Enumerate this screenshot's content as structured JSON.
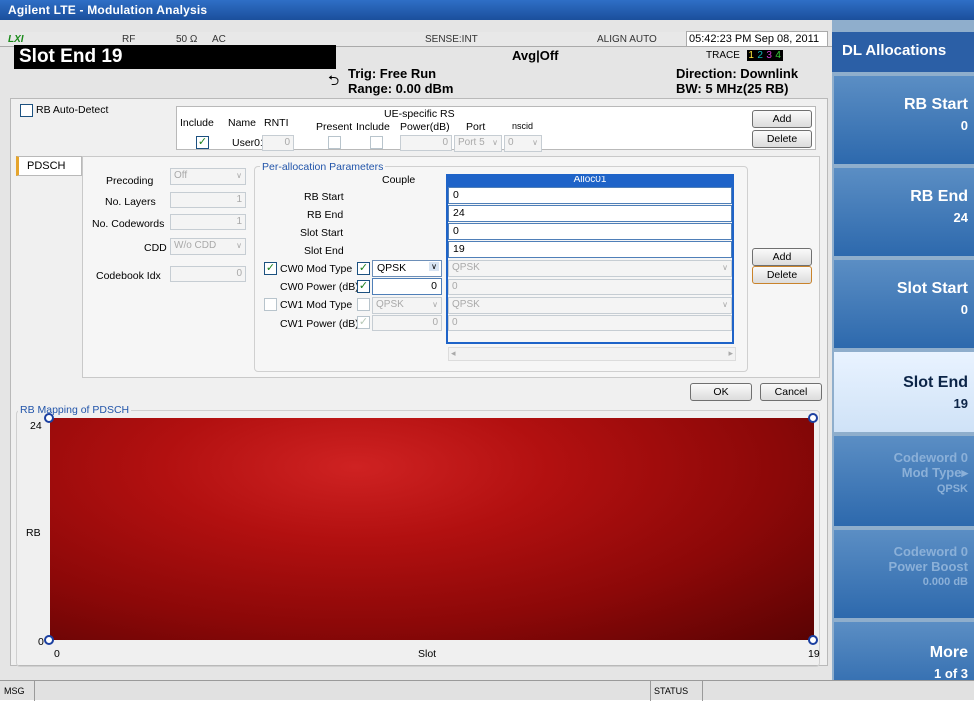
{
  "window": {
    "title": "Agilent LTE - Modulation Analysis"
  },
  "status_row": {
    "lxi": "LXI",
    "rf": "RF",
    "impedance": "50 Ω",
    "coupling": "AC",
    "sense": "SENSE:INT",
    "align": "ALIGN AUTO",
    "datetime": "05:42:23 PM Sep 08, 2011"
  },
  "header": {
    "active_param": "Slot End 19",
    "avg": "Avg|Off",
    "trig": "Trig: Free Run",
    "range": "Range: 0.00 dBm",
    "direction": "Direction: Downlink",
    "bw": "BW: 5 MHz(25 RB)",
    "trace_label": "TRACE",
    "trace_nums": [
      "1",
      "2",
      "3",
      "4"
    ]
  },
  "dialog": {
    "rb_auto_detect": "RB Auto-Detect",
    "user_table": {
      "headers": {
        "include": "Include",
        "name": "Name",
        "rnti": "RNTI",
        "ue_rs": "UE-specific RS",
        "present": "Present",
        "include2": "Include",
        "power": "Power(dB)",
        "port": "Port",
        "nscid": "nscid"
      },
      "row": {
        "name": "User01",
        "rnti": "0",
        "power": "0",
        "port": "Port 5",
        "nscid": "0"
      }
    },
    "add_label": "Add",
    "delete_label": "Delete",
    "pdsch_tab": "PDSCH",
    "precoding": {
      "label": "Precoding",
      "value": "Off"
    },
    "layers": {
      "label": "No. Layers",
      "value": "1"
    },
    "codewords": {
      "label": "No. Codewords",
      "value": "1"
    },
    "cdd": {
      "label": "CDD",
      "value": "W/o CDD"
    },
    "codebook": {
      "label": "Codebook Idx",
      "value": "0"
    },
    "per_alloc": {
      "title": "Per-allocation Parameters",
      "couple": "Couple",
      "col_header": "Alloc01",
      "rb_start": {
        "label": "RB Start",
        "value": "0"
      },
      "rb_end": {
        "label": "RB End",
        "value": "24"
      },
      "slot_start": {
        "label": "Slot Start",
        "value": "0"
      },
      "slot_end": {
        "label": "Slot End",
        "value": "19"
      },
      "cw0_mod": {
        "label": "CW0 Mod Type",
        "couple_value": "QPSK",
        "value": "QPSK"
      },
      "cw0_power": {
        "label": "CW0 Power (dB)",
        "couple_value": "0",
        "value": "0"
      },
      "cw1_mod": {
        "label": "CW1 Mod Type",
        "couple_value": "QPSK",
        "value": "QPSK"
      },
      "cw1_power": {
        "label": "CW1 Power (dB)",
        "couple_value": "0",
        "value": "0"
      }
    },
    "ok_label": "OK",
    "cancel_label": "Cancel",
    "mapping": {
      "title": "RB Mapping of PDSCH",
      "y_label": "RB",
      "x_label": "Slot",
      "y_max": "24",
      "y_min": "0",
      "x_min": "0",
      "x_max": "19"
    }
  },
  "softkeys": {
    "menu_title": "DL Allocations",
    "items": [
      {
        "label": "RB Start",
        "value": "0"
      },
      {
        "label": "RB End",
        "value": "24"
      },
      {
        "label": "Slot Start",
        "value": "0"
      },
      {
        "label": "Slot End",
        "value": "19"
      },
      {
        "label": "Codeword 0",
        "label2": "Mod Type▸",
        "value": "QPSK"
      },
      {
        "label": "Codeword 0",
        "label2": "Power Boost",
        "value": "0.000 dB"
      },
      {
        "label": "More",
        "value": "1 of 3"
      }
    ]
  },
  "statusbar": {
    "msg": "MSG",
    "status": "STATUS"
  },
  "colors": {
    "accent": "#1b4f9c",
    "fill": "#a80d0d",
    "softkey": "#3b78bd"
  }
}
